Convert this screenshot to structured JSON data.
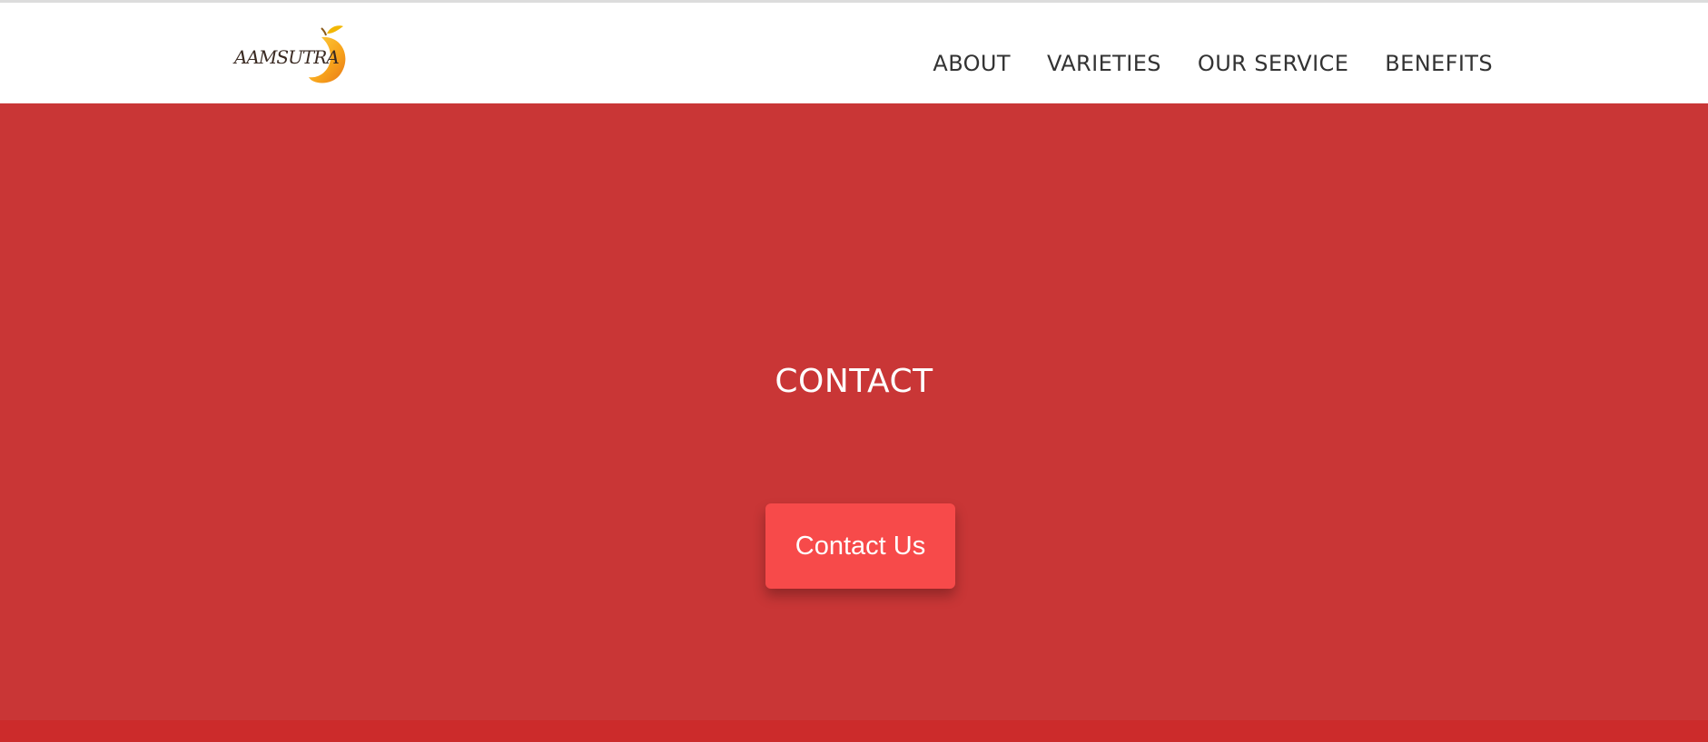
{
  "brand": {
    "logo_text": "AAMSUTRA",
    "logo_icon": "mango-icon",
    "accent_color": "#F5A623"
  },
  "nav": {
    "items": [
      {
        "label": "ABOUT"
      },
      {
        "label": "VARIETIES"
      },
      {
        "label": "OUR SERVICE"
      },
      {
        "label": "BENEFITS"
      }
    ]
  },
  "hero": {
    "title": "CONTACT",
    "button_label": "Contact Us",
    "background_color": "#C93636",
    "button_color": "#F74A4A"
  }
}
